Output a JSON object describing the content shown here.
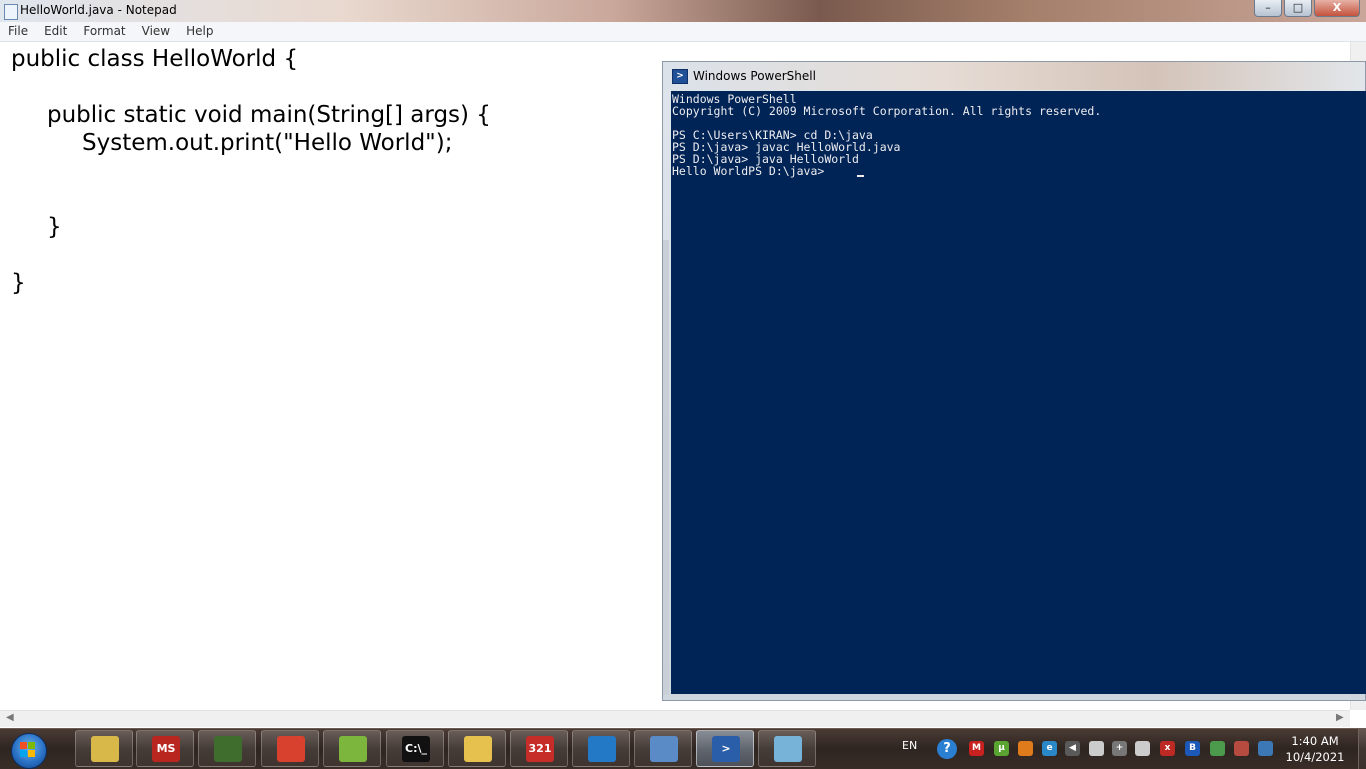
{
  "notepad": {
    "title": "HelloWorld.java - Notepad",
    "menu": [
      "File",
      "Edit",
      "Format",
      "View",
      "Help"
    ],
    "code_lines": [
      "public class HelloWorld {",
      "public static void main(String[] args) {",
      "System.out.print(\"Hello World\");",
      "}",
      "}"
    ],
    "window_buttons": {
      "minimize": "–",
      "maximize": "□",
      "close": "X"
    }
  },
  "powershell": {
    "title": "Windows PowerShell",
    "lines": [
      "Windows PowerShell",
      "Copyright (C) 2009 Microsoft Corporation. All rights reserved.",
      "",
      "PS C:\\Users\\KIRAN> cd D:\\java",
      "PS D:\\java> javac HelloWorld.java",
      "PS D:\\java> java HelloWorld",
      "Hello WorldPS D:\\java> "
    ],
    "background_color": "#012456"
  },
  "taskbar": {
    "apps": [
      {
        "name": "windows-explorer-icon",
        "label": "",
        "color": "#d9b84a"
      },
      {
        "name": "ms-office-icon",
        "label": "MS",
        "color": "#b8261f"
      },
      {
        "name": "computer-icon",
        "label": "",
        "color": "#3e6d2d"
      },
      {
        "name": "chrome-icon",
        "label": "",
        "color": "#d9412f"
      },
      {
        "name": "notepad-plus-icon",
        "label": "",
        "color": "#7db63c"
      },
      {
        "name": "cmd-icon",
        "label": "C:\\_",
        "color": "#111111"
      },
      {
        "name": "folder-icon",
        "label": "",
        "color": "#e6c14e"
      },
      {
        "name": "calendar-icon",
        "label": "321",
        "color": "#c62d28"
      },
      {
        "name": "vscode-icon",
        "label": "",
        "color": "#2479c6"
      },
      {
        "name": "paint-icon",
        "label": "",
        "color": "#5a8bc7"
      },
      {
        "name": "powershell-icon",
        "label": ">",
        "color": "#2a5ea8"
      },
      {
        "name": "notepad-icon",
        "label": "",
        "color": "#77b2d8"
      }
    ],
    "tray": {
      "language": "EN",
      "icons": [
        {
          "name": "help-icon",
          "label": "?",
          "color": "#2a7fd3"
        },
        {
          "name": "mcafee-icon",
          "label": "M",
          "color": "#c8211f"
        },
        {
          "name": "utorrent-icon",
          "label": "µ",
          "color": "#5aa531"
        },
        {
          "name": "app-orange-icon",
          "label": "",
          "color": "#e07b1b"
        },
        {
          "name": "ie-icon",
          "label": "e",
          "color": "#2a88c9"
        },
        {
          "name": "volume-icon",
          "label": "◀",
          "color": "#5a5a5a"
        },
        {
          "name": "battery-icon",
          "label": "",
          "color": "#cccccc"
        },
        {
          "name": "move-icon",
          "label": "+",
          "color": "#777777"
        },
        {
          "name": "signal-icon",
          "label": "",
          "color": "#cccccc"
        },
        {
          "name": "network-error-icon",
          "label": "x",
          "color": "#bd2a24"
        },
        {
          "name": "bluetooth-icon",
          "label": "B",
          "color": "#1c58b8"
        },
        {
          "name": "drive-icon",
          "label": "",
          "color": "#4c9a4c"
        },
        {
          "name": "network-tools-icon",
          "label": "",
          "color": "#b84b3f"
        },
        {
          "name": "monitor-icon",
          "label": "",
          "color": "#3b78b5"
        }
      ]
    },
    "clock": {
      "time": "1:40 AM",
      "date": "10/4/2021"
    }
  }
}
